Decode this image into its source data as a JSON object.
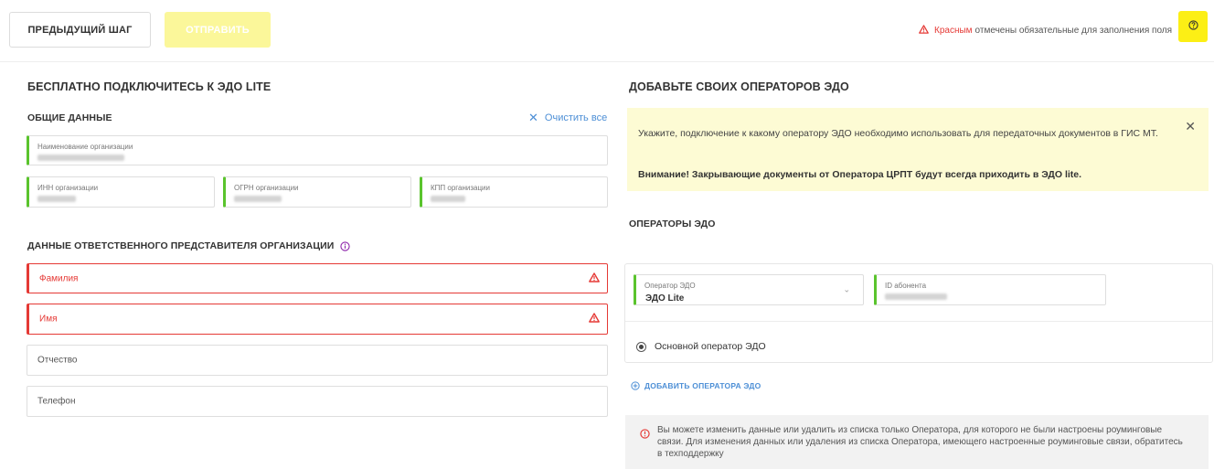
{
  "toolbar": {
    "prev_label": "ПРЕДЫДУЩИЙ ШАГ",
    "send_label": "ОТПРАВИТЬ",
    "required_note_red": "Красным",
    "required_note_rest": "отмечены обязательные для заполнения поля"
  },
  "left": {
    "title": "БЕСПЛАТНО ПОДКЛЮЧИТЕСЬ К ЭДО LITE",
    "general_heading": "ОБЩИЕ ДАННЫЕ",
    "clear_all": "Очистить все",
    "org_name_label": "Наименование организации",
    "inn_label": "ИНН организации",
    "ogrn_label": "ОГРН организации",
    "kpp_label": "КПП организации",
    "rep_heading": "ДАННЫЕ ОТВЕТСТВЕННОГО ПРЕДСТАВИТЕЛЯ ОРГАНИЗАЦИИ",
    "surname_placeholder": "Фамилия",
    "name_placeholder": "Имя",
    "patronymic_placeholder": "Отчество",
    "phone_placeholder": "Телефон"
  },
  "right": {
    "title": "ДОБАВЬТЕ СВОИХ ОПЕРАТОРОВ ЭДО",
    "info_text": "Укажите, подключение к какому оператору ЭДО необходимо использовать для передаточных документов в ГИС МТ.",
    "info_bold": "Внимание! Закрывающие документы от Оператора ЦРПТ будут всегда приходить в ЭДО lite.",
    "operators_heading": "ОПЕРАТОРЫ ЭДО",
    "operator_label": "Оператор ЭДО",
    "operator_value": "ЭДО Lite",
    "subscriber_label": "ID абонента",
    "main_operator_label": "Основной оператор ЭДО",
    "add_operator": "ДОБАВИТЬ ОПЕРАТОРА ЭДО",
    "warning_text": "Вы можете изменить данные или удалить из списка только Оператора, для которого не были настроены роуминговые связи. Для изменения данных или удаления из списка Оператора, имеющего настроенные роуминговые связи, обратитесь в техподдержку"
  },
  "colors": {
    "accent_yellow": "#fcef15",
    "disabled_yellow": "#fbf79a",
    "error_red": "#e53935",
    "ok_green": "#5ac42d",
    "link_blue": "#4d8fd6",
    "info_purple": "#8e24aa"
  },
  "icons": [
    "warning-triangle-icon",
    "question-circle-icon",
    "close-icon",
    "info-circle-icon",
    "chevron-down-icon",
    "plus-circle-icon"
  ]
}
